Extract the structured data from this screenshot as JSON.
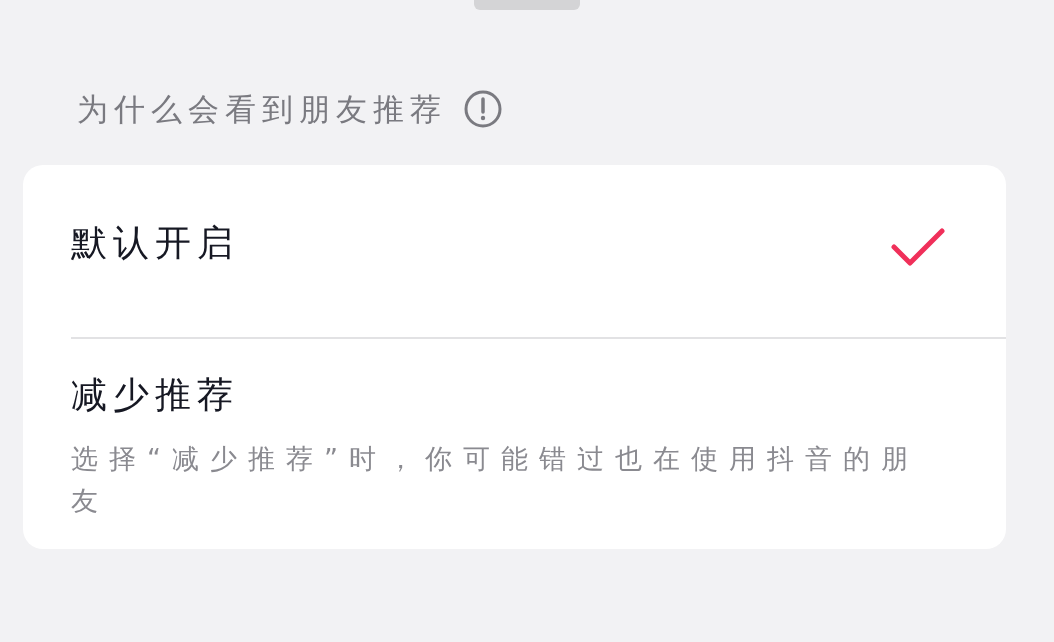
{
  "header": {
    "title": "为什么会看到朋友推荐"
  },
  "options": [
    {
      "label": "默认开启",
      "selected": true
    },
    {
      "label": "减少推荐",
      "selected": false,
      "description": "选择“减少推荐”时，你可能错过也在使用抖音的朋友"
    }
  ]
}
